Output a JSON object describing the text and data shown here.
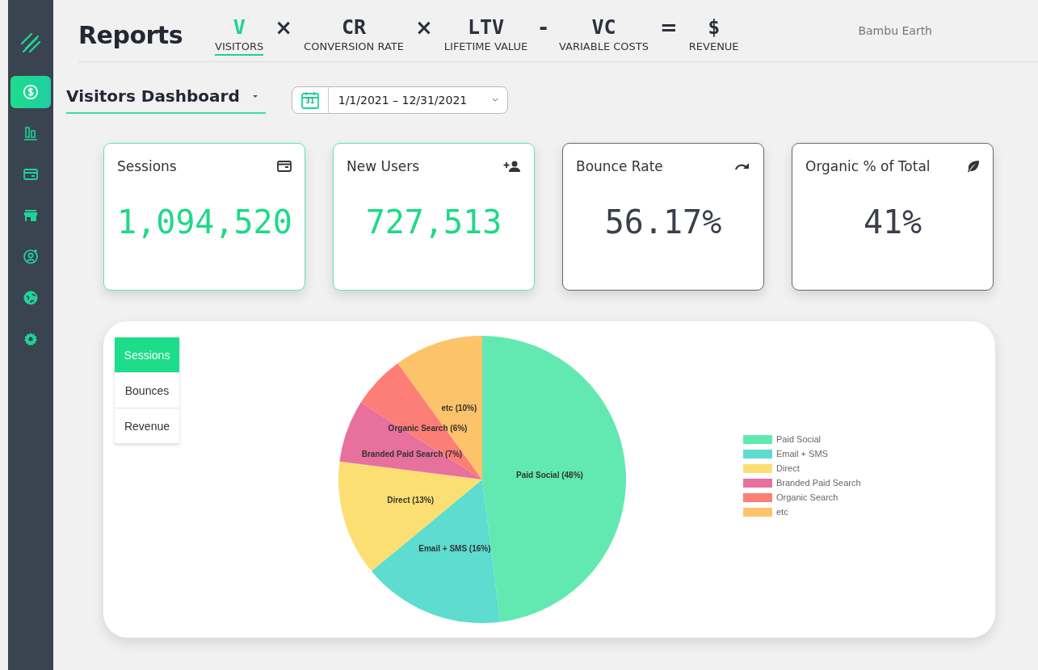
{
  "header": {
    "title": "Reports",
    "account": "Bambu Earth",
    "formula": [
      {
        "kind": "term",
        "abbr": "V",
        "label": "VISITORS",
        "selected": true
      },
      {
        "kind": "operator",
        "symbol": "×"
      },
      {
        "kind": "term",
        "abbr": "CR",
        "label": "CONVERSION RATE",
        "selected": false
      },
      {
        "kind": "operator",
        "symbol": "×"
      },
      {
        "kind": "term",
        "abbr": "LTV",
        "label": "LIFETIME VALUE",
        "selected": false
      },
      {
        "kind": "operator",
        "symbol": "-"
      },
      {
        "kind": "term",
        "abbr": "VC",
        "label": "VARIABLE COSTS",
        "selected": false
      },
      {
        "kind": "operator",
        "symbol": "="
      },
      {
        "kind": "term",
        "abbr": "$",
        "label": "REVENUE",
        "selected": false
      }
    ]
  },
  "sidebar": {
    "items": [
      {
        "selected": true
      },
      {
        "selected": false
      },
      {
        "selected": false
      },
      {
        "selected": false
      },
      {
        "selected": false
      },
      {
        "selected": false
      },
      {
        "selected": false
      }
    ]
  },
  "dashboard": {
    "title": "Visitors Dashboard",
    "date_range": "1/1/2021 – 12/31/2021",
    "calendar_day": "31"
  },
  "cards": [
    {
      "title": "Sessions",
      "value": "1,094,520",
      "highlighted": true
    },
    {
      "title": "New Users",
      "value": "727,513",
      "highlighted": true
    },
    {
      "title": "Bounce Rate",
      "value": "56.17%",
      "highlighted": false
    },
    {
      "title": "Organic % of Total",
      "value": "41%",
      "highlighted": false
    }
  ],
  "chart_tabs": [
    {
      "label": "Sessions",
      "selected": true
    },
    {
      "label": "Bounces",
      "selected": false
    },
    {
      "label": "Revenue",
      "selected": false
    }
  ],
  "chart": {
    "legend": [
      {
        "color": "#62e9b1"
      },
      {
        "color": "#5ddccf"
      },
      {
        "color": "#fcdf72"
      },
      {
        "color": "#e7709d"
      },
      {
        "color": "#fd7e77"
      },
      {
        "color": "#fdc36b"
      }
    ],
    "chart_data": {
      "type": "pie",
      "categories": [
        "Paid Social",
        "Email + SMS",
        "Direct",
        "Branded Paid Search",
        "Organic Search",
        "etc"
      ],
      "values": [
        48,
        16,
        13,
        7,
        6,
        10
      ],
      "value_labels": [
        "Paid Social (48%)",
        "Email + SMS (16%)",
        "Direct (13%)",
        "Branded Paid Search (7%)",
        "Organic Search (6%)",
        "etc (10%)"
      ]
    }
  }
}
